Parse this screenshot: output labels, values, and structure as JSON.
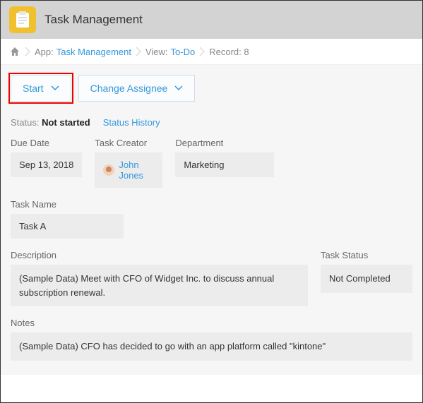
{
  "header": {
    "title": "Task Management"
  },
  "breadcrumbs": {
    "app_label": "App:",
    "app_value": "Task Management",
    "view_label": "View:",
    "view_value": "To-Do",
    "record": "Record: 8"
  },
  "actions": {
    "start": "Start",
    "change_assignee": "Change Assignee"
  },
  "status": {
    "label": "Status:",
    "value": "Not started",
    "history": "Status History"
  },
  "fields": {
    "due_date": {
      "label": "Due Date",
      "value": "Sep 13, 2018"
    },
    "creator": {
      "label": "Task Creator",
      "value": "John Jones"
    },
    "department": {
      "label": "Department",
      "value": "Marketing"
    },
    "task_name": {
      "label": "Task Name",
      "value": "Task A"
    },
    "description": {
      "label": "Description",
      "value": "(Sample Data) Meet with CFO of Widget Inc. to discuss annual subscription renewal."
    },
    "task_status": {
      "label": "Task Status",
      "value": "Not Completed"
    },
    "notes": {
      "label": "Notes",
      "value": "(Sample Data) CFO has decided to go with an app platform called \"kintone\""
    }
  }
}
